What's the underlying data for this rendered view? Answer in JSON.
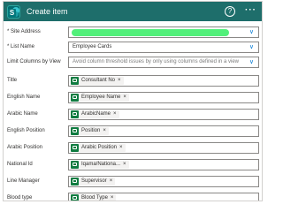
{
  "header": {
    "logo_letter": "S",
    "title": "Create item",
    "help_glyph": "?",
    "more_glyph": "···"
  },
  "fields": {
    "site_address": {
      "label": "* Site Address"
    },
    "list_name": {
      "label": "* List Name",
      "value": "Employee Cards"
    },
    "limit_columns": {
      "label": "Limit Columns by View",
      "placeholder": "Avoid column threshold issues by only using columns defined in a view"
    },
    "title": {
      "label": "Title",
      "token": "Consultant No"
    },
    "english_name": {
      "label": "English Name",
      "token": "Employee Name"
    },
    "arabic_name": {
      "label": "Arabic Name",
      "token": "ArabicName"
    },
    "english_position": {
      "label": "English Position",
      "token": "Position"
    },
    "arabic_position": {
      "label": "Arabic Position",
      "token": "Arabic Position"
    },
    "national_id": {
      "label": "National Id",
      "token": "Iqama/Nationa..."
    },
    "line_manager": {
      "label": "Line Manager",
      "token": "Supervisor"
    },
    "blood_type": {
      "label": "Blood type",
      "token": "Blood Type"
    }
  },
  "remove_glyph": "×",
  "chevron_glyph": "∨",
  "colors": {
    "header_bg": "#1e6e6b",
    "token_icon": "#107c41",
    "redaction": "#52f07a",
    "chevron": "#0078d4"
  }
}
